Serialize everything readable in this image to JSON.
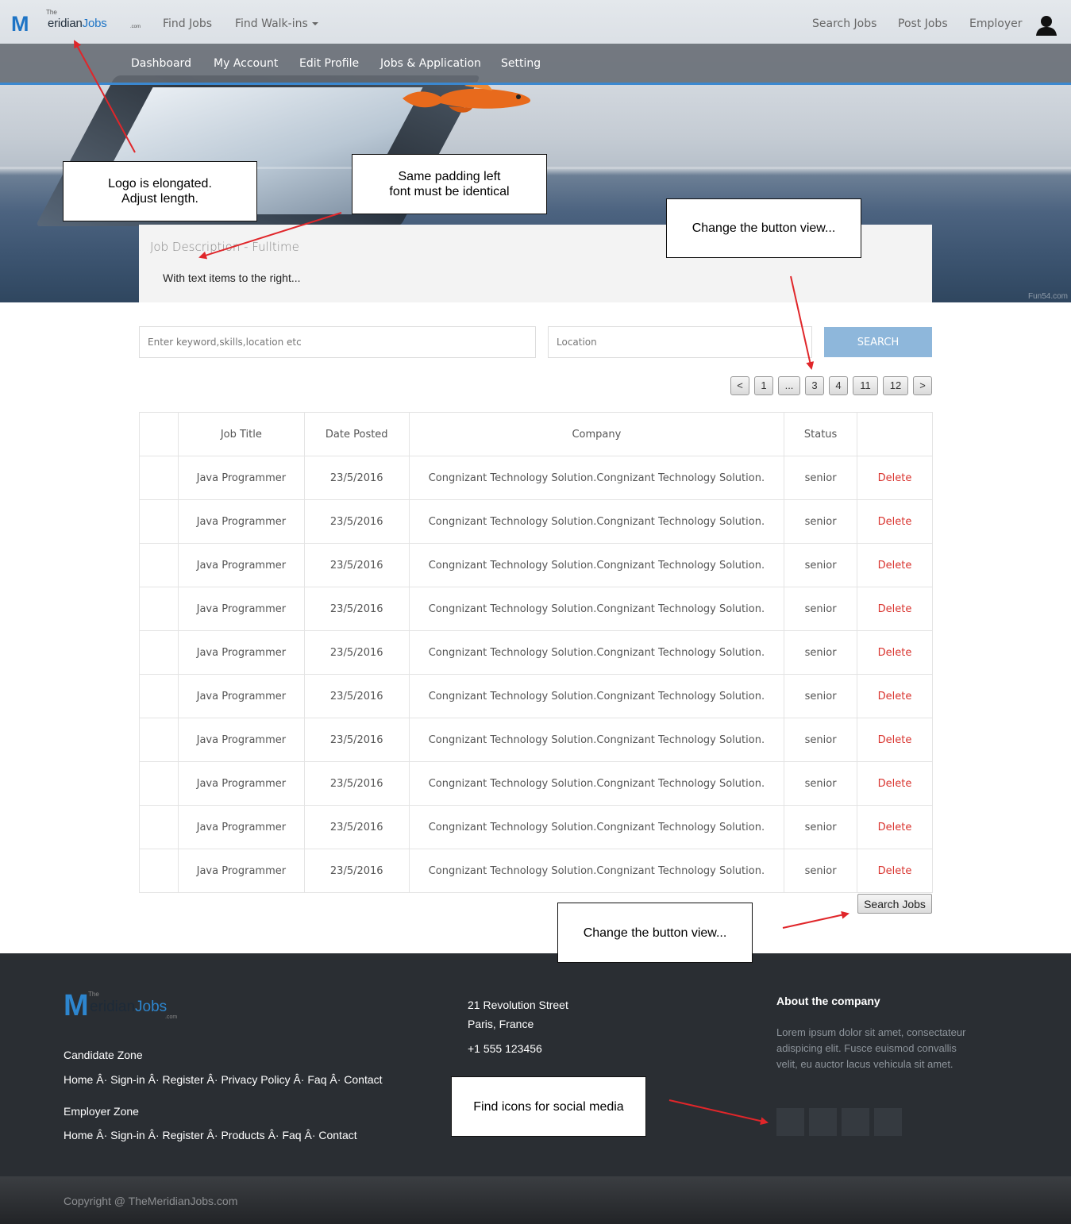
{
  "brand": {
    "logo_the": "The",
    "logo_m": "M",
    "logo_eridian": "eridian",
    "logo_jobs": "Jobs",
    "logo_com": ".com"
  },
  "hero": {
    "watermark": "Fun54.com"
  },
  "topnav": {
    "left": [
      "Find Jobs",
      "Find Walk-ins"
    ],
    "right": [
      "Search Jobs",
      "Post Jobs",
      "Employer"
    ]
  },
  "subnav": [
    "Dashboard",
    "My Account",
    "Edit Profile",
    "Jobs & Application",
    "Setting"
  ],
  "description": {
    "title": "Job Description - Fulltime",
    "text": "With text items to the right..."
  },
  "search": {
    "keyword_placeholder": "Enter keyword,skills,location etc",
    "location_placeholder": "Location",
    "button": "SEARCH"
  },
  "pagination": [
    "<",
    "1",
    "...",
    "3",
    "4",
    "11",
    "12",
    ">"
  ],
  "table": {
    "headers": [
      "",
      "Job Title",
      "Date Posted",
      "Company",
      "Status",
      ""
    ],
    "rows": [
      {
        "title": "Java Programmer",
        "date": "23/5/2016",
        "company": "Congnizant Technology Solution.Congnizant Technology Solution.",
        "status": "senior",
        "action": "Delete"
      },
      {
        "title": "Java Programmer",
        "date": "23/5/2016",
        "company": "Congnizant Technology Solution.Congnizant Technology Solution.",
        "status": "senior",
        "action": "Delete"
      },
      {
        "title": "Java Programmer",
        "date": "23/5/2016",
        "company": "Congnizant Technology Solution.Congnizant Technology Solution.",
        "status": "senior",
        "action": "Delete"
      },
      {
        "title": "Java Programmer",
        "date": "23/5/2016",
        "company": "Congnizant Technology Solution.Congnizant Technology Solution.",
        "status": "senior",
        "action": "Delete"
      },
      {
        "title": "Java Programmer",
        "date": "23/5/2016",
        "company": "Congnizant Technology Solution.Congnizant Technology Solution.",
        "status": "senior",
        "action": "Delete"
      },
      {
        "title": "Java Programmer",
        "date": "23/5/2016",
        "company": "Congnizant Technology Solution.Congnizant Technology Solution.",
        "status": "senior",
        "action": "Delete"
      },
      {
        "title": "Java Programmer",
        "date": "23/5/2016",
        "company": "Congnizant Technology Solution.Congnizant Technology Solution.",
        "status": "senior",
        "action": "Delete"
      },
      {
        "title": "Java Programmer",
        "date": "23/5/2016",
        "company": "Congnizant Technology Solution.Congnizant Technology Solution.",
        "status": "senior",
        "action": "Delete"
      },
      {
        "title": "Java Programmer",
        "date": "23/5/2016",
        "company": "Congnizant Technology Solution.Congnizant Technology Solution.",
        "status": "senior",
        "action": "Delete"
      },
      {
        "title": "Java Programmer",
        "date": "23/5/2016",
        "company": "Congnizant Technology Solution.Congnizant Technology Solution.",
        "status": "senior",
        "action": "Delete"
      }
    ]
  },
  "search_jobs_button": "Search Jobs",
  "footer": {
    "candidate_zone": "Candidate Zone",
    "candidate_links": [
      "Home",
      "Sign-in",
      "Register",
      "Privacy Policy",
      "Faq",
      "Contact"
    ],
    "employer_zone": "Employer Zone",
    "employer_links": [
      "Home",
      "Sign-in",
      "Register",
      "Products",
      "Faq",
      "Contact"
    ],
    "link_separator": " Â· ",
    "address_line1": "21 Revolution Street",
    "address_line2": "Paris, France",
    "phone": "+1 555 123456",
    "about_title": "About the company",
    "about_text": "Lorem ipsum dolor sit amet, consectateur adispicing elit. Fusce euismod convallis velit, eu auctor lacus vehicula sit amet.",
    "copyright": "Copyright @ TheMeridianJobs.com"
  },
  "annotations": {
    "logo": [
      "Logo is elongated.",
      "Adjust length."
    ],
    "padding": [
      "Same padding left",
      "font must be identical"
    ],
    "button_top": "Change the button view...",
    "button_bottom": "Change the button view...",
    "social": "Find icons for social media"
  },
  "colors": {
    "accent": "#3b88d0",
    "search_button": "#8eb7db",
    "delete": "#d9342f",
    "footer_bg": "#2a2e33",
    "arrow": "#e0262a"
  }
}
